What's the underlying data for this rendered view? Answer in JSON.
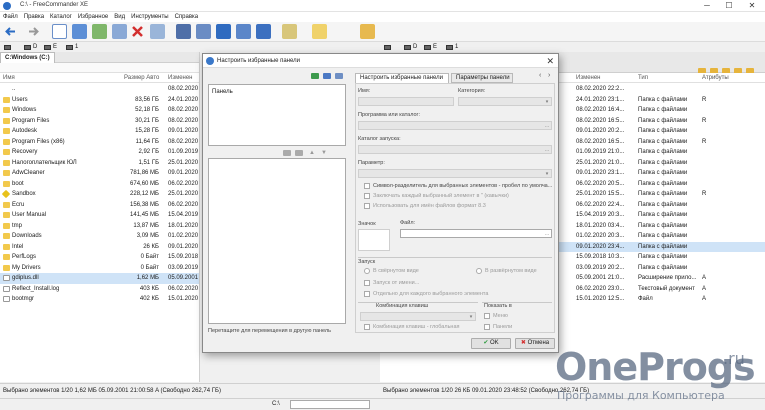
{
  "window": {
    "title": "C:\\ - FreeCommander XE",
    "minimize": "─",
    "maximize": "☐",
    "close": "✕"
  },
  "menu": [
    "Файл",
    "Правка",
    "Каталог",
    "Избранное",
    "Вид",
    "Инструменты",
    "Справка"
  ],
  "drives_left": [
    "D",
    "E",
    "1"
  ],
  "drives_right": [
    "D",
    "E",
    "1"
  ],
  "left": {
    "tab": "C:Windows (C:)",
    "path": "C:\\",
    "columns": {
      "name": "Имя",
      "size": "Размер Авто",
      "modified": "Изменен"
    },
    "rows": [
      {
        "name": "..",
        "size": "",
        "date": "08.02.2020 ",
        "type": "up"
      },
      {
        "name": "Users",
        "size": "83,56 ГБ",
        "date": "24.01.2020 ",
        "type": "folder"
      },
      {
        "name": "Windows",
        "size": "52,18 ГБ",
        "date": "08.02.2020 ",
        "type": "folder"
      },
      {
        "name": "Program Files",
        "size": "30,21 ГБ",
        "date": "08.02.2020 ",
        "type": "folder"
      },
      {
        "name": "Autodesk",
        "size": "15,28 ГБ",
        "date": "09.01.2020 ",
        "type": "folder"
      },
      {
        "name": "Program Files (x86)",
        "size": "11,64 ГБ",
        "date": "08.02.2020 ",
        "type": "folder"
      },
      {
        "name": "Recovery",
        "size": "2,92 ГБ",
        "date": "01.09.2019 ",
        "type": "folder"
      },
      {
        "name": "Налогоплательщик ЮЛ",
        "size": "1,51 ГБ",
        "date": "25.01.2020 ",
        "type": "folder"
      },
      {
        "name": "AdwCleaner",
        "size": "781,86 МБ",
        "date": "09.01.2020 ",
        "type": "folder"
      },
      {
        "name": "boot",
        "size": "674,60 МБ",
        "date": "06.02.2020 ",
        "type": "folder"
      },
      {
        "name": "Sandbox",
        "size": "228,12 МБ",
        "date": "25.01.2020 ",
        "type": "sandbox"
      },
      {
        "name": "Ecru",
        "size": "156,38 МБ",
        "date": "06.02.2020 ",
        "type": "folder"
      },
      {
        "name": "User Manual",
        "size": "141,45 МБ",
        "date": "15.04.2019 ",
        "type": "folder"
      },
      {
        "name": "tmp",
        "size": "13,87 МБ",
        "date": "18.01.2020 ",
        "type": "folder"
      },
      {
        "name": "Downloads",
        "size": "3,09 МБ",
        "date": "01.02.2020 ",
        "type": "folder"
      },
      {
        "name": "Intel",
        "size": "26 КБ",
        "date": "09.01.2020 ",
        "type": "folder"
      },
      {
        "name": "PerfLogs",
        "size": "0 Байт",
        "date": "15.09.2018 ",
        "type": "folder"
      },
      {
        "name": "My Drivers",
        "size": "0 Байт",
        "date": "03.09.2019 ",
        "type": "folder"
      },
      {
        "name": "gdiplus.dll",
        "size": "1,62 МБ",
        "date": "05.09.2001 ",
        "type": "file",
        "selected": true
      },
      {
        "name": "Reflect_Install.log",
        "size": "403 КБ",
        "date": "06.02.2020 ",
        "type": "file"
      },
      {
        "name": "bootmgr",
        "size": "402 КБ",
        "date": "15.01.2020 ",
        "type": "file"
      }
    ]
  },
  "right": {
    "columns": {
      "modified": "Изменен",
      "type": "Тип",
      "attrs": "Атрибуты"
    },
    "rows": [
      {
        "num": "",
        "date": "08.02.2020 22:2...",
        "type": "",
        "attr": ""
      },
      {
        "num": "",
        "date": "24.01.2020 23:1...",
        "type": "Папка с файлами",
        "attr": "R"
      },
      {
        "num": "",
        "date": "08.02.2020 16:4...",
        "type": "Папка с файлами",
        "attr": ""
      },
      {
        "num": "",
        "date": "08.02.2020 16:5...",
        "type": "Папка с файлами",
        "attr": "R"
      },
      {
        "num": "",
        "date": "09.01.2020 20:2...",
        "type": "Папка с файлами",
        "attr": ""
      },
      {
        "num": "",
        "date": "08.02.2020 16:5...",
        "type": "Папка с файлами",
        "attr": "R"
      },
      {
        "num": "",
        "date": "01.09.2019 21:0...",
        "type": "Папка с файлами",
        "attr": ""
      },
      {
        "num": "",
        "date": "25.01.2020 21:0...",
        "type": "Папка с файлами",
        "attr": ""
      },
      {
        "num": "",
        "date": "09.01.2020 23:1...",
        "type": "Папка с файлами",
        "attr": ""
      },
      {
        "num": "",
        "date": "06.02.2020 20:5...",
        "type": "Папка с файлами",
        "attr": ""
      },
      {
        "num": "",
        "date": "25.01.2020 15:5...",
        "type": "Папка с файлами",
        "attr": "R"
      },
      {
        "num": "",
        "date": "06.02.2020 22:4...",
        "type": "Папка с файлами",
        "attr": ""
      },
      {
        "num": "",
        "date": "15.04.2019 20:3...",
        "type": "Папка с файлами",
        "attr": ""
      },
      {
        "num": "",
        "date": "18.01.2020 03:4...",
        "type": "Папка с файлами",
        "attr": ""
      },
      {
        "num": "",
        "date": "01.02.2020 20:3...",
        "type": "Папка с файлами",
        "attr": ""
      },
      {
        "num": "",
        "date": "09.01.2020 23:4...",
        "type": "Папка с файлами",
        "attr": "",
        "selected": true
      },
      {
        "num": "",
        "date": "15.09.2018 10:3...",
        "type": "Папка с файлами",
        "attr": ""
      },
      {
        "num": "",
        "date": "03.09.2019 20:2...",
        "type": "Папка с файлами",
        "attr": ""
      },
      {
        "num": "",
        "date": "05.09.2001 21:0...",
        "type": "Расширение прило...",
        "attr": "A"
      },
      {
        "num": "",
        "date": "06.02.2020 23:0...",
        "type": "Текстовый документ",
        "attr": "A"
      },
      {
        "num": "",
        "date": "15.01.2020 12:5...",
        "type": "Файл",
        "attr": "A"
      }
    ]
  },
  "status": {
    "left": "Выбрано элементов 1/20    1,62 МБ    05.09.2001 21:00:58    A    (Свободно 262,74 ГБ)",
    "right": "Выбрано элементов 1/20    26 КБ    09.01.2020 23:48:52        (Свободно 262,74 ГБ)",
    "cmd_path": "C:\\"
  },
  "dialog": {
    "title": "Настроить избранные панели",
    "list_header": "Панель",
    "drag_hint": "Перетащите для перемещения в другую панель",
    "tabs": [
      "Настроить избранные панели",
      "Параметры панели"
    ],
    "name_label": "Имя:",
    "category_label": "Категория:",
    "program_label": "Программа или каталог:",
    "start_dir_label": "Каталог запуска:",
    "param_label": "Параметр:",
    "chk_separator": "Символ-разделитель для выбранных элементов - пробел по умолча...",
    "chk_quotes": "Заключать каждый выбранный элемент в \" (кавычки)",
    "chk_short_names": "Использовать для имён файлов формат 8.3",
    "icon_label": "Значок",
    "file_label": "Файл:",
    "launch_label": "Запуск",
    "rad_minimized": "В свёрнутом виде",
    "rad_maximized": "В развёрнутом виде",
    "chk_run_as": "Запуск от имени...",
    "chk_each": "Отдельно для каждого выбранного элемента",
    "hotkey_label": "Комбинация клавиш",
    "chk_global": "Комбинация клавиш - глобальная",
    "show_label": "Показать в",
    "chk_menu": "Меню",
    "chk_panels": "Панели",
    "ok": "OK",
    "cancel": "Отмена"
  },
  "watermark": {
    "brand": "OneProgs",
    "suffix": ".ru",
    "tagline": "Программы для Компьютера"
  },
  "colors": {
    "accent": "#2b6cc4",
    "folder": "#f2c94c",
    "selection": "#cfe3f7"
  }
}
